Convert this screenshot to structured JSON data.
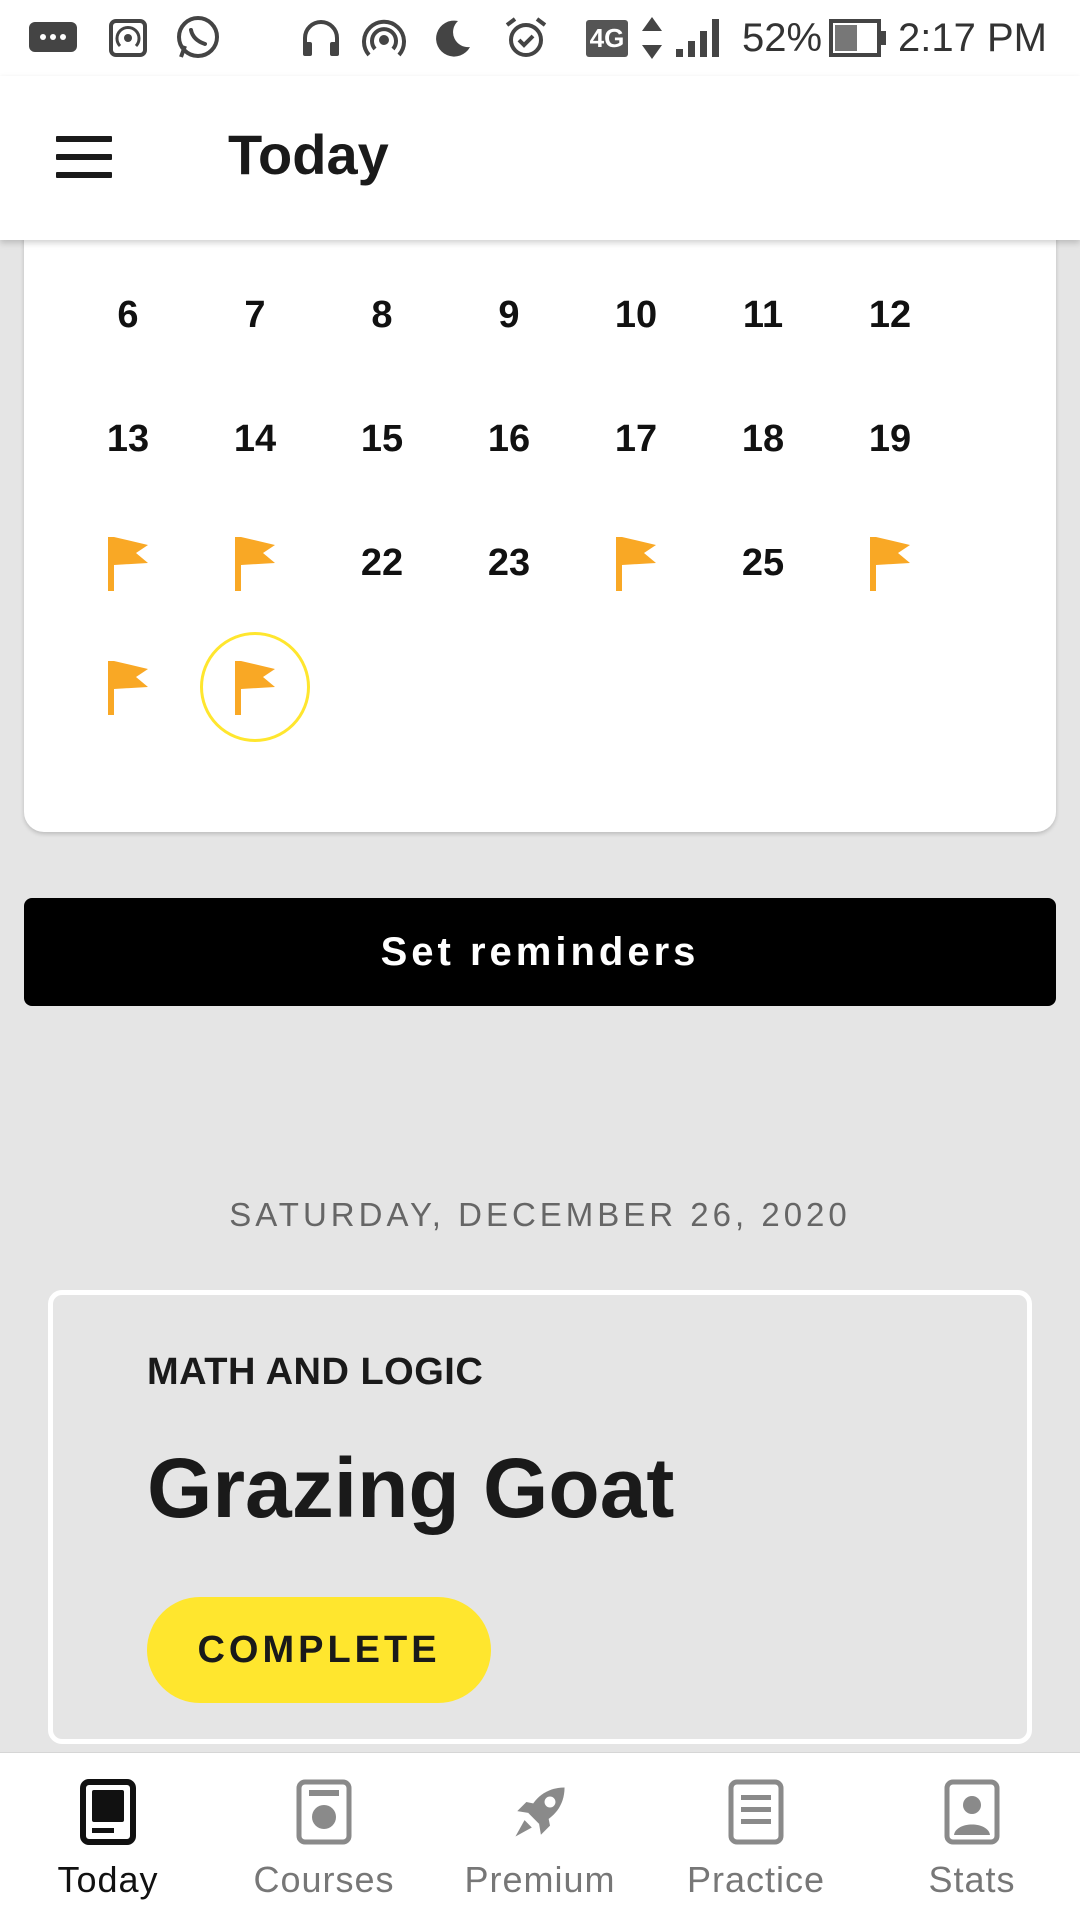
{
  "status_bar": {
    "network": "4G",
    "battery": "52%",
    "time": "2:17 PM"
  },
  "app_bar": {
    "title": "Today"
  },
  "calendar": {
    "rows": [
      [
        "6",
        "7",
        "8",
        "9",
        "10",
        "11",
        "12"
      ],
      [
        "13",
        "14",
        "15",
        "16",
        "17",
        "18",
        "19"
      ],
      [
        "flag",
        "flag",
        "22",
        "23",
        "flag",
        "25",
        "flag"
      ],
      [
        "flag",
        "flag-today"
      ]
    ],
    "flag_color": "#f9a825",
    "today_ring_color": "#ffe62e"
  },
  "reminders": {
    "label": "Set reminders"
  },
  "date_heading": "SATURDAY, DECEMBER 26, 2020",
  "problem": {
    "category": "MATH AND LOGIC",
    "title": "Grazing Goat",
    "status": "COMPLETE"
  },
  "bottom_nav": {
    "items": [
      {
        "label": "Today",
        "icon": "today-icon",
        "active": true
      },
      {
        "label": "Courses",
        "icon": "courses-icon",
        "active": false
      },
      {
        "label": "Premium",
        "icon": "rocket-icon",
        "active": false
      },
      {
        "label": "Practice",
        "icon": "practice-icon",
        "active": false
      },
      {
        "label": "Stats",
        "icon": "stats-icon",
        "active": false
      }
    ]
  },
  "colors": {
    "accent_yellow": "#ffe62e",
    "button_black": "#000000",
    "page_background": "#e5e5e5"
  }
}
